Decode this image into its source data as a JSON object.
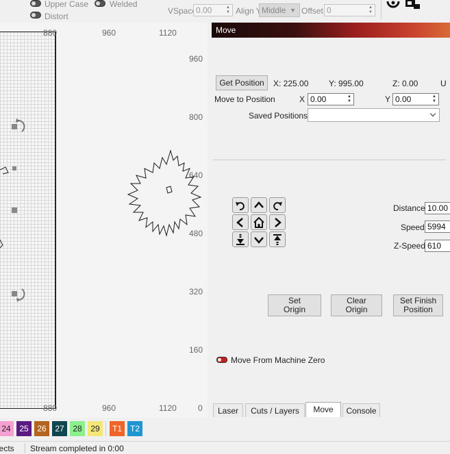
{
  "toolbar": {
    "upper_case": "Upper Case",
    "welded": "Welded",
    "distort": "Distort",
    "vspace_label": "VSpace",
    "vspace_value": "0.00",
    "align_y_label": "Align Y",
    "align_y_value": "Middle",
    "offset_label": "Offset",
    "offset_value": "0"
  },
  "canvas": {
    "x_labels_top": [
      "880",
      "960",
      "1120"
    ],
    "x_labels_bottom": [
      "880",
      "960",
      "1120"
    ],
    "y_labels": [
      "960",
      "800",
      "640",
      "480",
      "320",
      "160",
      "0"
    ]
  },
  "panel": {
    "title": "Move",
    "get_position": "Get Position",
    "pos_x": "X: 225.00",
    "pos_y": "Y: 995.00",
    "pos_z": "Z: 0.00",
    "pos_u": "U",
    "move_to_position": "Move to Position",
    "x_label": "X",
    "x_value": "0.00",
    "y_label": "Y",
    "y_value": "0.00",
    "saved_positions": "Saved Positions:",
    "distance_label": "Distance",
    "distance_value": "10.00",
    "speed_label": "Speed",
    "speed_value": "5994",
    "zspeed_label": "Z-Speed",
    "zspeed_value": "610",
    "set_origin": "Set\nOrigin",
    "clear_origin": "Clear\nOrigin",
    "set_finish": "Set Finish\nPosition",
    "move_from_zero": "Move From Machine Zero",
    "tabs": [
      "Laser",
      "Cuts / Layers",
      "Move",
      "Console"
    ],
    "active_tab": "Move"
  },
  "colors": {
    "swatches": [
      {
        "label": "24",
        "color": "#f5a0d2"
      },
      {
        "label": "25",
        "color": "#5a1a82"
      },
      {
        "label": "26",
        "color": "#b4641e"
      },
      {
        "label": "27",
        "color": "#0f4650"
      },
      {
        "label": "28",
        "color": "#8cf08c"
      },
      {
        "label": "29",
        "color": "#f5e678"
      },
      {
        "label": "T1",
        "color": "#f06428"
      },
      {
        "label": "T2",
        "color": "#1e96d2"
      }
    ]
  },
  "status": {
    "objects": "jects",
    "stream": "Stream completed in 0:00"
  }
}
